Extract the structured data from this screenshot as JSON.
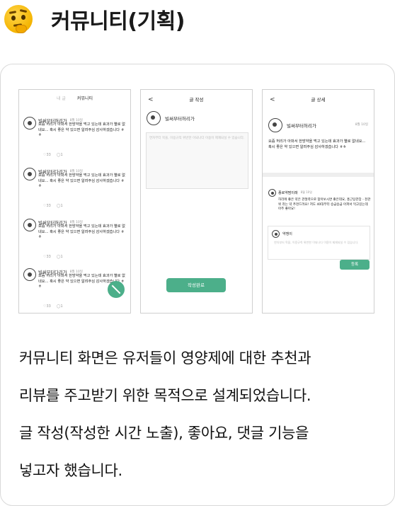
{
  "page": {
    "title": "커뮤니티(기획)",
    "emoji_icon": "thinking-face-emoji"
  },
  "screen_list": {
    "tabs": [
      "내 글",
      "커뮤니티"
    ],
    "posts": [
      {
        "name": "빌써부터허리가",
        "date": "8월 10일",
        "body": "요즘 허리가 아파서 한방약을 먹고 있는데 효과가 별로 없네요... 혹시 좋은 약 있으면 알려주심 감사하겠습니다 ㅎㅎ",
        "likes": "33",
        "comments": "1"
      },
      {
        "name": "빌써부터다리가",
        "date": "8월 10일",
        "body": "요즘 허리가 아파서 한방약을 먹고 있는데 효과가 별로 없네요... 혹시 좋은 약 있으면 알려주심 감사하겠습니다 ㅎㅎ",
        "likes": "33",
        "comments": "1"
      },
      {
        "name": "빌써부터허리가",
        "date": "8월 10일",
        "body": "요즘 허리가 아파서 한방약을 먹고 있는데 효과가 별로 없네요... 혹시 좋은 약 있으면 알려주심 감사하겠습니다 ㅎㅎ",
        "likes": "33",
        "comments": "1"
      },
      {
        "name": "빌써부터다리가",
        "date": "8월 10일",
        "body": "요즘 허리가 아파서 한방약을 먹고 있는데 효과가 별로 없네요... 혹시 좋은 약 있으면 알려주심 감사하겠습니다 ㅎㅎ",
        "likes": "33",
        "comments": "1"
      }
    ]
  },
  "screen_write": {
    "back": "<",
    "title": "글 작성",
    "author": "빌써부터허리가",
    "placeholder": "연차부터 목을, 이용규칙 위반한 이되나다 이용이 제재되실 수 있습니다.",
    "submit": "작성완료"
  },
  "screen_detail": {
    "back": "<",
    "title": "글 상세",
    "author": "빌써부터허리가",
    "date": "8월 10일",
    "body": "요즘 허리가 아파서 한방약을 먹고 있는데 효과가 별로 없네요... 혹시 좋은 약 있으면 알려주심 감사하겠습니다 ㅎㅎ",
    "comment": {
      "name": "종로약팜이래",
      "date": "8월 10일",
      "text": "허리에 좋은 약은 관절력으로 찾아보시면 좋은데요, 홍근탕관장 - 천관위 라는 약 추천드려요! 저도 40대부터 승급승급 아파서 먹고있는데 아주 좋아요!"
    },
    "reply_name": "약쟁이",
    "reply_placeholder": "연차부터 목을, 이용규칙 위반한 이되나다 이용이 제재되실 수 있습니다.",
    "register": "등록"
  },
  "description": {
    "line1": "커뮤니티 화면은 유저들이 영양제에 대한 추천과",
    "line2": "리뷰를 주고받기 위한 목적으로 설계되었습니다.",
    "line3": "글 작성(작성한 시간 노출), 좋아요, 댓글 기능을",
    "line4": "넣고자 했습니다."
  },
  "colors": {
    "accent": "#4caf8a",
    "border": "#d9d9d9"
  }
}
